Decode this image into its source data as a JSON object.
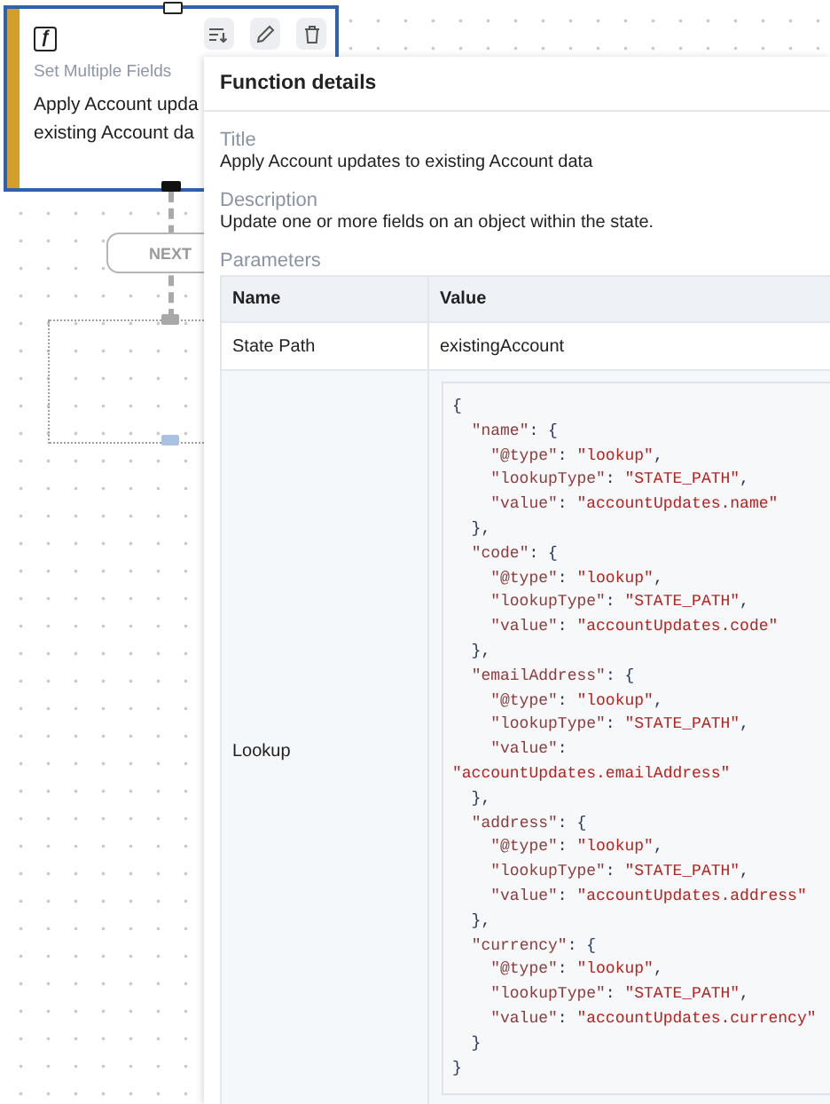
{
  "canvas": {
    "node": {
      "icon_glyph": "ƒ",
      "type_label": "Set Multiple Fields",
      "title_lines": [
        "Apply Account upda",
        "existing Account da"
      ],
      "selected": true
    },
    "connector_label": "NEXT"
  },
  "panel": {
    "title": "Function details",
    "sections": [
      {
        "heading": "Title",
        "text": "Apply Account updates to existing Account data"
      },
      {
        "heading": "Description",
        "text": "Update one or more fields on an object within the state."
      }
    ],
    "parameters": {
      "heading": "Parameters",
      "columns": [
        "Name",
        "Value"
      ],
      "rows": [
        {
          "kind": "text",
          "name": "State Path",
          "value": "existingAccount"
        },
        {
          "kind": "code",
          "name": "Lookup",
          "lines": [
            "{",
            "  \"name\": {",
            "    \"@type\": \"lookup\",",
            "    \"lookupType\": \"STATE_PATH\",",
            "    \"value\": \"accountUpdates.name\"",
            "  },",
            "  \"code\": {",
            "    \"@type\": \"lookup\",",
            "    \"lookupType\": \"STATE_PATH\",",
            "    \"value\": \"accountUpdates.code\"",
            "  },",
            "  \"emailAddress\": {",
            "    \"@type\": \"lookup\",",
            "    \"lookupType\": \"STATE_PATH\",",
            "    \"value\":",
            "\"accountUpdates.emailAddress\"",
            "  },",
            "  \"address\": {",
            "    \"@type\": \"lookup\",",
            "    \"lookupType\": \"STATE_PATH\",",
            "    \"value\": \"accountUpdates.address\"",
            "  },",
            "  \"currency\": {",
            "    \"@type\": \"lookup\",",
            "    \"lookupType\": \"STATE_PATH\",",
            "    \"value\": \"accountUpdates.currency\"",
            "  }",
            "}"
          ]
        }
      ]
    }
  }
}
